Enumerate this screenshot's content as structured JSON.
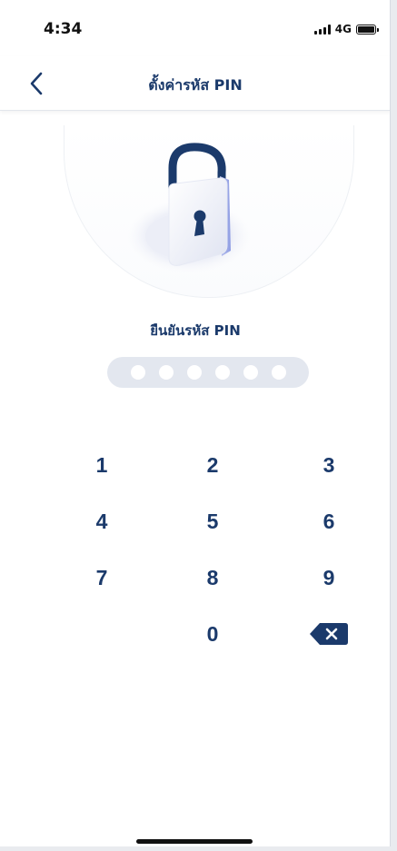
{
  "status_bar": {
    "time": "4:34",
    "network": "4G"
  },
  "header": {
    "title": "ตั้งค่ารหัส PIN"
  },
  "pin": {
    "label": "ยืนยันรหัส PIN",
    "length": 6,
    "entered": 0
  },
  "keypad": {
    "keys": [
      "1",
      "2",
      "3",
      "4",
      "5",
      "6",
      "7",
      "8",
      "9",
      "0"
    ],
    "delete_icon": "backspace-icon"
  },
  "colors": {
    "primary": "#1b3a6b",
    "dot_track": "#e3e7ef",
    "background": "#ffffff"
  }
}
